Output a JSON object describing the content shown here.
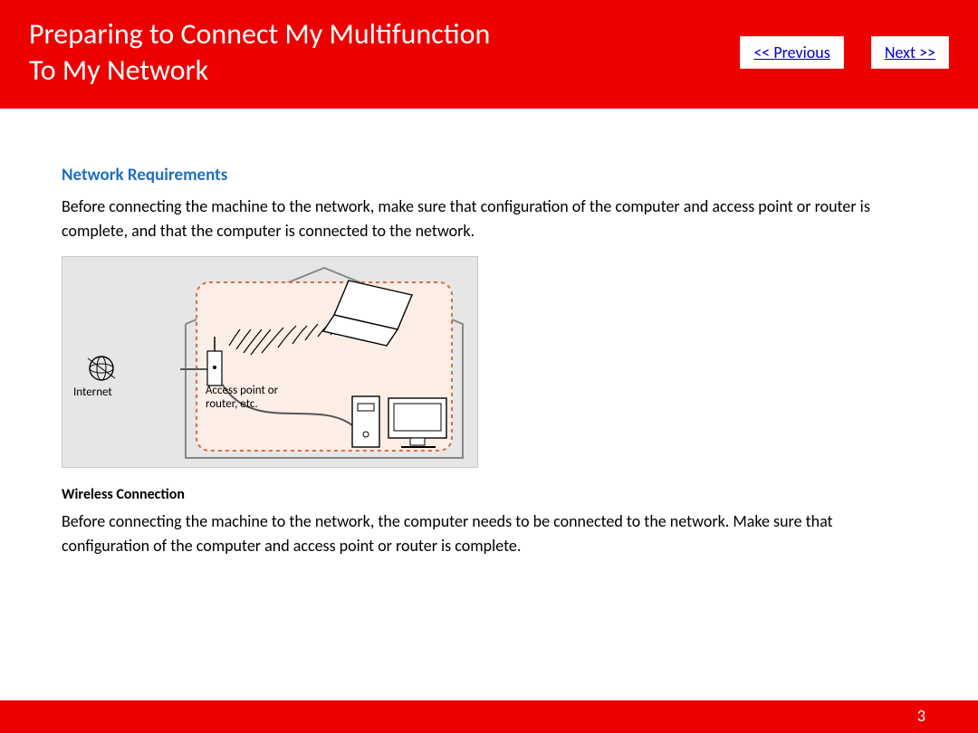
{
  "header": {
    "title_line1": "Preparing to Connect My Multifunction",
    "title_line2": "To My Network",
    "prev_label": "<< Previous",
    "next_label": "Next >>"
  },
  "content": {
    "section_heading": "Network Requirements",
    "intro_para": "Before connecting the machine to the network, make sure that configuration of the computer and access point or router is complete, and that the computer is connected to the network.",
    "diagram": {
      "internet_label": "Internet",
      "access_point_label_l1": "Access point or",
      "access_point_label_l2": "router, etc."
    },
    "sub_heading": "Wireless Connection",
    "sub_para": "Before connecting the machine to the network, the computer needs to be connected to the network. Make sure that configuration of the computer and access point or router is complete."
  },
  "footer": {
    "page_number": "3"
  }
}
